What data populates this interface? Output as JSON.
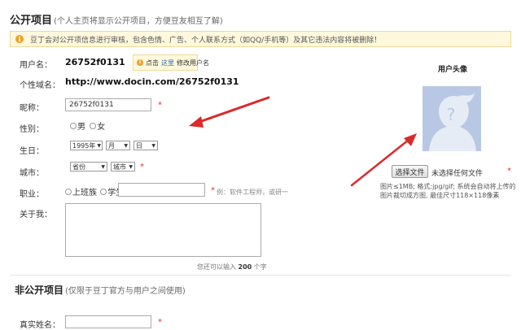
{
  "public_section": {
    "title": "公开项目",
    "subtitle": "(个人主页将显示公开项目，方便豆友相互了解)"
  },
  "notice": {
    "icon": "info-icon",
    "text": "豆丁会对公开项信息进行审核，包含色情、广告、个人联系方式（如QQ/手机等）及其它违法内容将被删除！"
  },
  "fields": {
    "username": {
      "label": "用户名：",
      "value": "26752f0131"
    },
    "username_tip": {
      "prefix": "点击",
      "link": "这里",
      "suffix": "修改用户名"
    },
    "domain": {
      "label": "个性域名：",
      "value": "http://www.docin.com/26752f0131"
    },
    "nickname": {
      "label": "昵称：",
      "value": "26752f0131",
      "required": "*"
    },
    "gender": {
      "label": "性别：",
      "options": [
        "男",
        "女"
      ]
    },
    "birthday": {
      "label": "生日：",
      "year": "1995年",
      "month": "月",
      "day": "日"
    },
    "city": {
      "label": "城市：",
      "province": "省份",
      "city": "城市",
      "required": "*"
    },
    "job": {
      "label": "职业：",
      "options": [
        "上班族",
        "学生"
      ],
      "required": "*",
      "hint": "例：软件工程师，或研一"
    },
    "about": {
      "label": "关于我：",
      "counter_prefix": "您还可以输入",
      "counter_value": "200",
      "counter_suffix": "个字"
    }
  },
  "avatar": {
    "title": "用户头像",
    "choose_file_label": "选择文件",
    "no_file_text": "未选择任何文件",
    "required": "*",
    "hint": "图片≤1MB; 格式:jpg/gif; 系统会自动将上传的图片裁切成方图, 最佳尺寸118×118像素"
  },
  "private_section": {
    "title": "非公开项目",
    "subtitle": "(仅限于豆丁官方与用户之间使用)",
    "realname_label": "真实姓名：",
    "required": "*"
  },
  "colors": {
    "notice_bg": "#fff8dc",
    "required": "#e03030",
    "arrow": "#d92b2b",
    "link": "#2b6fb6",
    "avatar_bg": "#b8c8e4"
  }
}
